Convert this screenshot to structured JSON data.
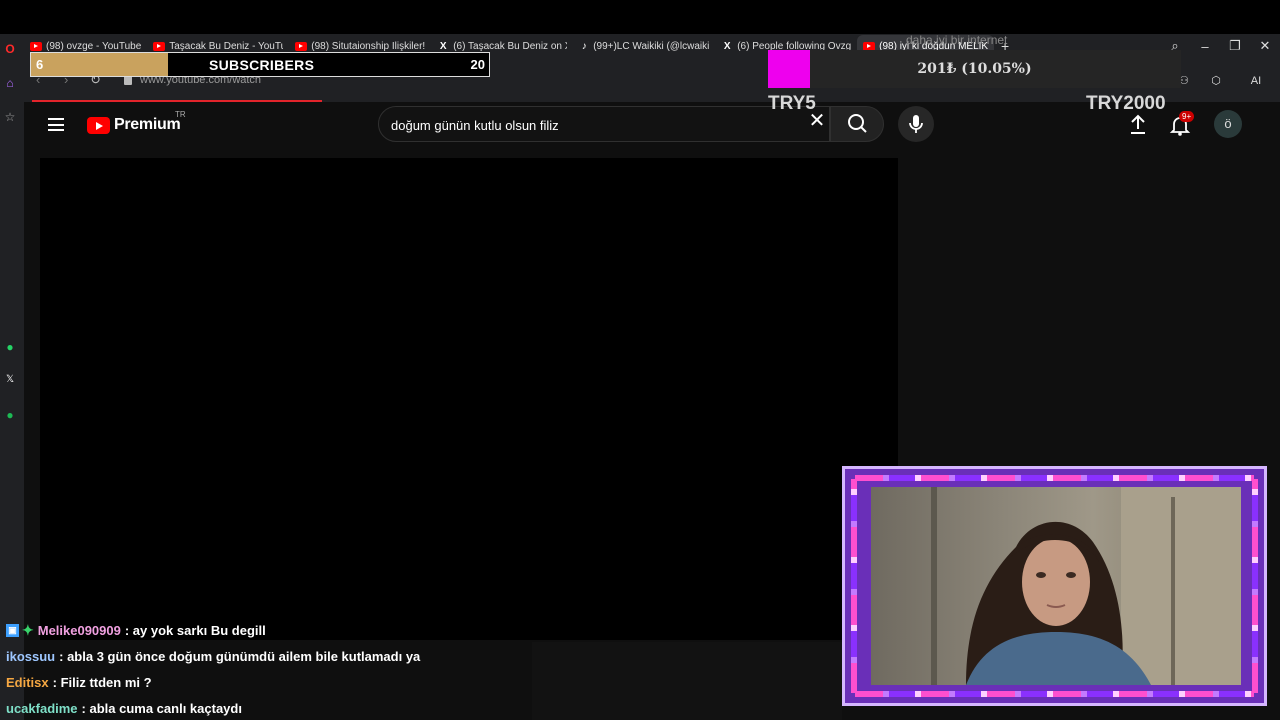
{
  "browser": {
    "tabs": [
      {
        "icon": "youtube-icon",
        "label": "(98) ovzge - YouTube"
      },
      {
        "icon": "youtube-icon",
        "label": "Taşacak Bu Deniz - YouTub"
      },
      {
        "icon": "youtube-icon",
        "label": "(98) Situtaionship İlişkiler!"
      },
      {
        "icon": "x-icon",
        "label": "(6) Taşacak Bu Deniz on X"
      },
      {
        "icon": "tiktok-icon",
        "label": "(99+)LC Waikiki (@lcwaiki"
      },
      {
        "icon": "x-icon",
        "label": "(6) People following Ovzg"
      },
      {
        "icon": "youtube-icon",
        "label": "(98) iyi ki doğdun MELİK"
      }
    ],
    "url": "www.youtube.com/watch",
    "ai_label": "AI"
  },
  "youtube": {
    "logo_text": "Premium",
    "country_code": "TR",
    "search_value": "doğum günün kutlu olsun filiz",
    "notification_count": "9+",
    "avatar_letter": "ö"
  },
  "overlays": {
    "subscribers": {
      "current": "6",
      "label": "SUBSCRIBERS",
      "goal": "20",
      "progress": 0.3
    },
    "donation_goal": {
      "text": "201₺ (10.05%)",
      "progress": 0.1005,
      "left_label": "TRY5",
      "right_label": "TRY2000"
    },
    "faint_text": "daha iyi bir internet"
  },
  "chat": [
    {
      "user": "Melike090909",
      "user_color": "#f0a0e0",
      "message": ": ay yok sarkı Bu degill",
      "badges": true
    },
    {
      "user": "ikossuu",
      "user_color": "#9ec7ff",
      "message": ": abla 3 gün önce doğum günümdü ailem bile kutlamadı ya",
      "badges": false
    },
    {
      "user": "Editisx",
      "user_color": "#f5a742",
      "message": ": Filiz ttden mi ?",
      "badges": false
    },
    {
      "user": "ucakfadime",
      "user_color": "#7fe0c8",
      "message": ": abla cuma canlı kaçtaydı",
      "badges": false
    }
  ],
  "colors": {
    "accent": "#ff0000",
    "goal_fill": "#ee00ee",
    "sub_fill": "#c9a25e",
    "cam_frame": "#6a2fb8"
  }
}
